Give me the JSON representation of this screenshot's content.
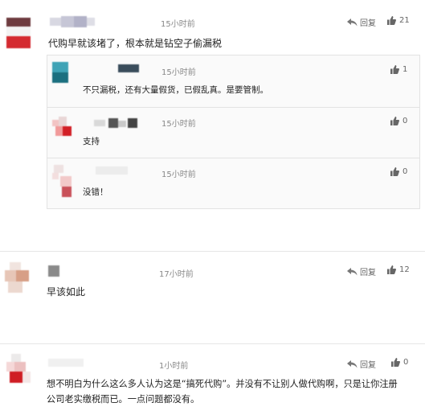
{
  "comments": [
    {
      "time": "15小时前",
      "reply_label": "回复",
      "likes": "21",
      "text": "代购早就该堵了，根本就是钻空子偷漏税",
      "replies": [
        {
          "time": "15小时前",
          "likes": "1",
          "text": "不只漏税，还有大量假货，已假乱真。是要管制。"
        },
        {
          "time": "15小时前",
          "likes": "0",
          "text": "支持"
        },
        {
          "time": "15小时前",
          "likes": "0",
          "text": "没错！"
        }
      ]
    },
    {
      "time": "17小时前",
      "reply_label": "回复",
      "likes": "12",
      "text": "早该如此"
    },
    {
      "time": "1小时前",
      "reply_label": "回复",
      "likes": "0",
      "text_line1": "想不明白为什么这么多人认为这是“搞死代购”。并没有不让别人做代购啊，只是让你注册",
      "text_line2": "公司老实缴税而已。一点问题都没有。"
    }
  ]
}
